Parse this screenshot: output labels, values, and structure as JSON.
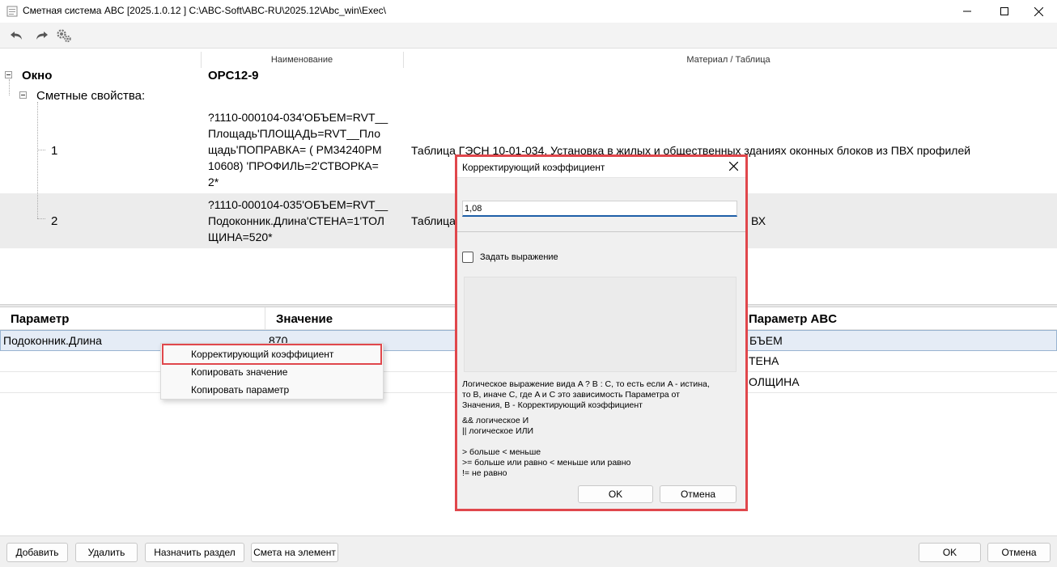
{
  "window": {
    "title": "Сметная система ABC [2025.1.0.12 ]   C:\\ABC-Soft\\ABC-RU\\2025.12\\Abc_win\\Exec\\",
    "minimize_icon": "minimize-icon",
    "maximize_icon": "maximize-icon",
    "close_icon": "close-icon"
  },
  "toolbar": {
    "undo_icon": "undo-icon",
    "redo_icon": "redo-icon",
    "settings_icon": "gears-icon"
  },
  "tree": {
    "headers": {
      "name": "Наименование",
      "material": "Материал / Таблица"
    },
    "root": {
      "label": "Окно",
      "name": "OPC12-9"
    },
    "group": {
      "label": "Сметные свойства:"
    },
    "rows": [
      {
        "index": "1",
        "formula_lines": [
          "?1110-000104-034'ОБЪЕМ=RVT__",
          "Площадь'ПЛОЩАДЬ=RVT__Пло",
          "щадь'ПОПРАВКА= ( PM34240PM",
          "10608)  'ПРОФИЛЬ=2'СТВОРКА=",
          "2*"
        ],
        "material": "Таблица ГЭСН 10-01-034. Установка в жилых и общественных зданиях оконных блоков из ПВХ профилей"
      },
      {
        "index": "2",
        "formula_lines": [
          "?1110-000104-035'ОБЪЕМ=RVT__",
          "Подоконник.Длина'СТЕНА=1'ТОЛ",
          "ЩИНА=520*"
        ],
        "material": "Таблица",
        "material_tail": "ВХ"
      }
    ]
  },
  "grid": {
    "headers": {
      "param": "Параметр",
      "value": "Значение",
      "abc": "Параметр ABC"
    },
    "rows": [
      {
        "param": "Подоконник.Длина",
        "value": "870",
        "abc": "БЪЕМ"
      },
      {
        "param": "",
        "value": "",
        "abc": "ТЕНА"
      },
      {
        "param": "",
        "value": "",
        "abc": "ОЛЩИНА"
      }
    ]
  },
  "context_menu": {
    "items": [
      "Корректирующий коэффициент",
      "Копировать значение",
      "Копировать параметр"
    ]
  },
  "dialog": {
    "title": "Корректирующий коэффициент",
    "value": "1,08",
    "checkbox_label": "Задать выражение",
    "checkbox_checked": false,
    "help_main": [
      "Логическое выражение вида A ? B : C, то есть если A  - истина,",
      "то B, иначе C, где A и C это зависимость Параметра от",
      "Значения, B - Корректирующий коэффициент"
    ],
    "help_logic": [
      "&& логическое И",
      "|| логическое ИЛИ"
    ],
    "help_compare": [
      "> больше   < меньше",
      ">= больше или равно   < меньше или равно",
      "!= не равно"
    ],
    "ok_label": "OK",
    "cancel_label": "Отмена"
  },
  "bottombar": {
    "add_label": "Добавить",
    "delete_label": "Удалить",
    "assign_label": "Назначить раздел",
    "estimate_label": "Смета на элемент",
    "ok_label": "OK",
    "cancel_label": "Отмена"
  },
  "colors": {
    "highlight": "#e0474c",
    "accent": "#1e5fa8",
    "selection": "#e5ecf6"
  }
}
